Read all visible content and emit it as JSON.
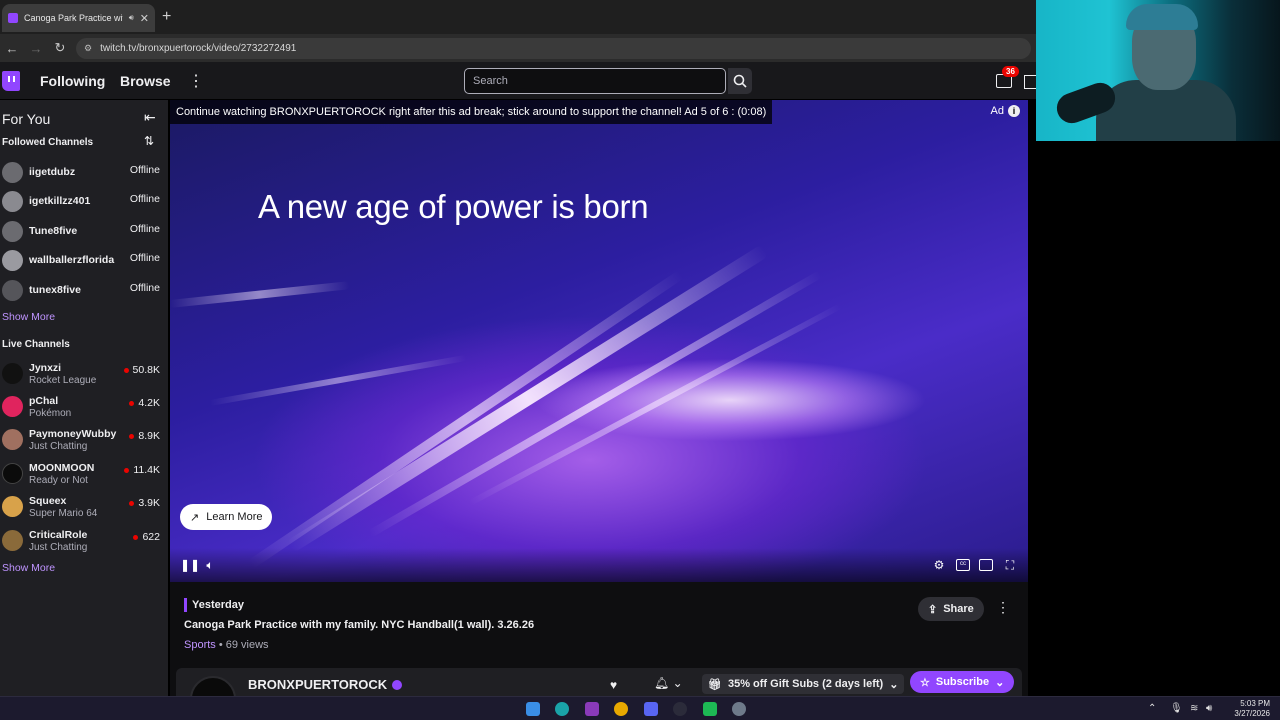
{
  "browser": {
    "tab_title": "Canoga Park Practice with m",
    "new_tab": "+",
    "url": "twitch.tv/bronxpuertorock/video/2732272491"
  },
  "topnav": {
    "following": "Following",
    "browse": "Browse",
    "more": "⋮",
    "search_placeholder": "Search",
    "notifications_count": "36"
  },
  "sidebar": {
    "header": "For You",
    "followed_title": "Followed Channels",
    "followed": [
      {
        "name": "iigetdubz",
        "status": "Offline"
      },
      {
        "name": "igetkillzz401",
        "status": "Offline"
      },
      {
        "name": "Tune8five",
        "status": "Offline"
      },
      {
        "name": "wallballerzflorida",
        "status": "Offline"
      },
      {
        "name": "tunex8five",
        "status": "Offline"
      }
    ],
    "show_more_1": "Show More",
    "live_title": "Live Channels",
    "live": [
      {
        "name": "Jynxzi",
        "game": "Rocket League",
        "viewers": "50.8K",
        "color": "#111111"
      },
      {
        "name": "pChal",
        "game": "Pokémon",
        "viewers": "4.2K",
        "color": "#e0245e"
      },
      {
        "name": "PaymoneyWubby",
        "game": "Just Chatting",
        "viewers": "8.9K",
        "color": "#a07060"
      },
      {
        "name": "MOONMOON",
        "game": "Ready or Not",
        "viewers": "11.4K",
        "color": "#0b0b0b"
      },
      {
        "name": "Squeex",
        "game": "Super Mario 64",
        "viewers": "3.9K",
        "color": "#d8a24a"
      },
      {
        "name": "CriticalRole",
        "game": "Just Chatting",
        "viewers": "622",
        "color": "#8a6a3a"
      }
    ],
    "show_more_2": "Show More"
  },
  "player": {
    "ad_banner": "Continue watching BRONXPUERTOROCK right after this ad break; stick around to support the channel! Ad 5 of 6 : (0:08)",
    "ad_label": "Ad",
    "headline": "A new age of power is born",
    "learn_more": "Learn More"
  },
  "video": {
    "date": "Yesterday",
    "title": "Canoga Park Practice with my family. NYC Handball(1 wall). 3.26.26",
    "category": "Sports",
    "views": " • 69 views",
    "share": "Share"
  },
  "channel": {
    "name": "BRONXPUERTOROCK",
    "gift_subs": "35% off Gift Subs (2 days left)",
    "subscribe": "Subscribe"
  },
  "taskbar": {
    "time": "5:03 PM",
    "date": "3/27/2026"
  },
  "colors": {
    "twitch_purple": "#9146ff",
    "live_red": "#eb0400",
    "link_purple": "#bf94ff"
  }
}
